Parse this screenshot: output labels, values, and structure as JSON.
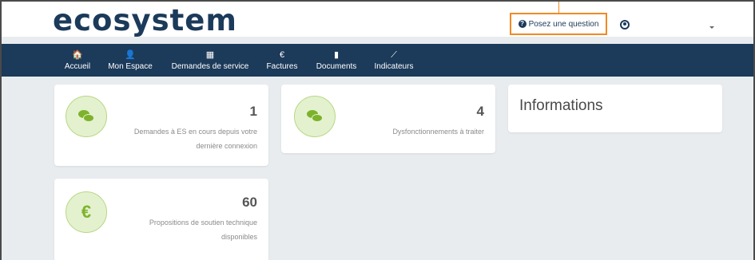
{
  "header": {
    "logo_text": "ecosystem",
    "ask_button_label": "Posez une question",
    "ask_icon": "question-circle-icon",
    "user_icon": "user-circle-icon",
    "dropdown_icon": "caret-down-icon"
  },
  "nav": {
    "items": [
      {
        "label": "Accueil",
        "icon": "home-icon",
        "glyph": "🏠"
      },
      {
        "label": "Mon Espace",
        "icon": "user-icon",
        "glyph": "👤"
      },
      {
        "label": "Demandes de service",
        "icon": "calendar-icon",
        "glyph": "▦"
      },
      {
        "label": "Factures",
        "icon": "euro-icon",
        "glyph": "€"
      },
      {
        "label": "Documents",
        "icon": "file-icon",
        "glyph": "▮"
      },
      {
        "label": "Indicateurs",
        "icon": "chart-icon",
        "glyph": "⟋"
      }
    ]
  },
  "cards": [
    {
      "count": "1",
      "description_line1": "Demandes à ES en cours depuis votre",
      "description_line2": "dernière connexion",
      "icon": "comments-icon"
    },
    {
      "count": "4",
      "description_line1": "Dysfonctionnements à traiter",
      "icon": "comments-icon"
    },
    {
      "count": "60",
      "description_line1": "Propositions de soutien technique",
      "description_line2": "disponibles",
      "icon": "euro-icon",
      "glyph": "€"
    }
  ],
  "info_panel": {
    "title": "Informations"
  },
  "colors": {
    "navy": "#1c3a5a",
    "accent_orange": "#f08a24",
    "green": "#7cb32b",
    "logo_yellow": "#f2b81f"
  }
}
